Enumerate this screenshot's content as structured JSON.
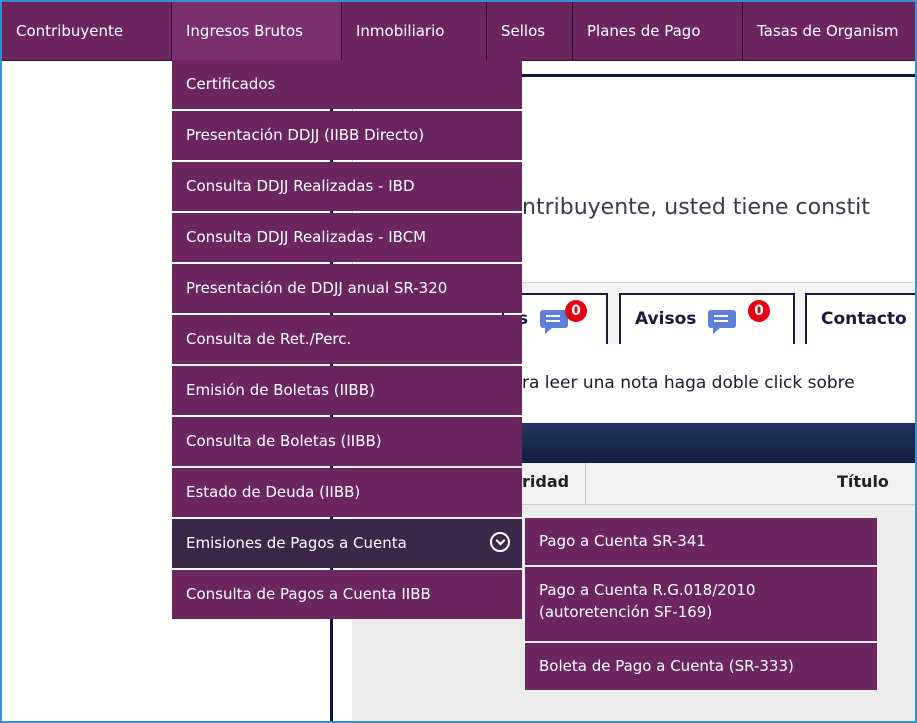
{
  "topnav": {
    "items": [
      "Contribuyente",
      "Ingresos Brutos",
      "Inmobiliario",
      "Sellos",
      "Planes de Pago",
      "Tasas de Organism"
    ]
  },
  "dropdown": {
    "items": [
      "Certificados",
      "Presentación DDJJ (IIBB Directo)",
      "Consulta DDJJ Realizadas - IBD",
      "Consulta DDJJ Realizadas - IBCM",
      "Presentación de DDJJ anual SR-320",
      "Consulta de Ret./Perc.",
      "Emisión de Boletas (IIBB)",
      "Consulta de Boletas (IIBB)",
      "Estado de Deuda (IIBB)",
      "Emisiones de Pagos a Cuenta",
      "Consulta de Pagos a Cuenta IIBB"
    ]
  },
  "submenu": {
    "item1": "Pago a Cuenta SR-341",
    "item2_line1": "Pago a Cuenta R.G.018/2010",
    "item2_line2": "(autoretención SF-169)",
    "item3": "Boleta de Pago a Cuenta (SR-333)"
  },
  "content": {
    "welcome": "ntribuyente, usted tiene constit",
    "tab_msg_label": "s",
    "tab_msg_count": "0",
    "tab_avisos_label": "Avisos",
    "tab_avisos_count": "0",
    "tab_contacto_label": "Contacto",
    "hint": "ra leer una nota haga doble click sobre",
    "col_prioridad": "ridad",
    "col_titulo": "Título"
  },
  "colors": {
    "menu_bg": "#6b2660",
    "menu_hover": "#3d2748",
    "badge": "#e60012",
    "grid_header": "#1a2a52",
    "frame_border": "#3a8fd0"
  }
}
